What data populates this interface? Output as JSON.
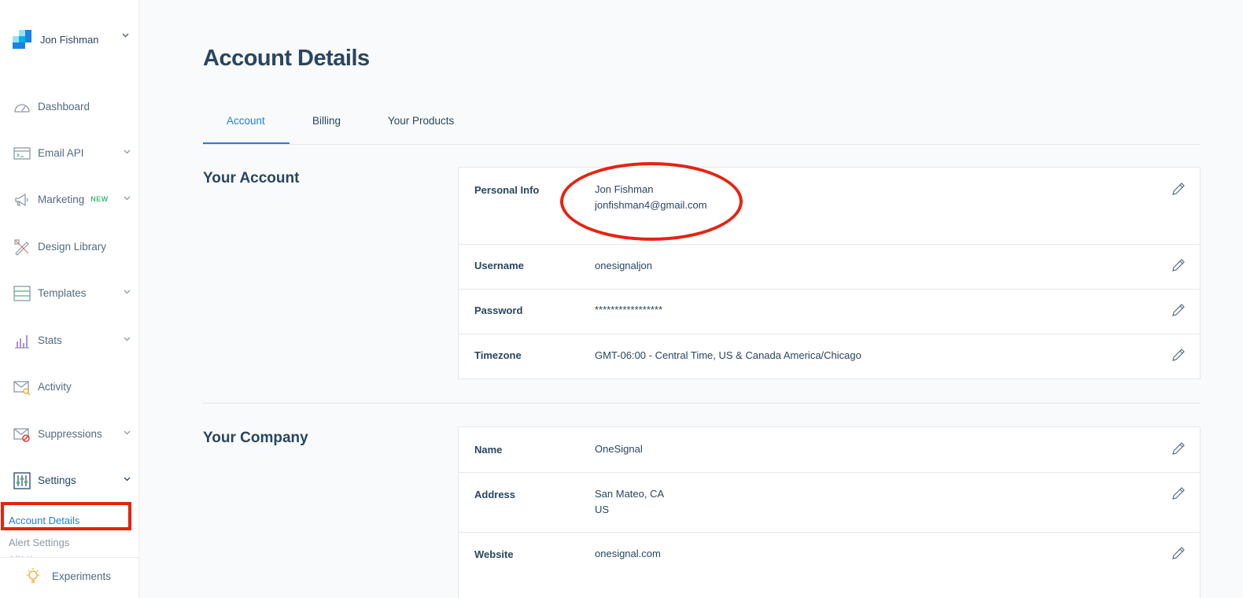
{
  "user": {
    "name": "Jon Fishman"
  },
  "sidebar": {
    "items": [
      {
        "label": "Dashboard",
        "icon": "dashboard-icon"
      },
      {
        "label": "Email API",
        "icon": "terminal-icon",
        "caret": true
      },
      {
        "label": "Marketing",
        "badge": "NEW",
        "icon": "megaphone-icon",
        "caret": true
      },
      {
        "label": "Design Library",
        "icon": "design-icon"
      },
      {
        "label": "Templates",
        "icon": "templates-icon",
        "caret": true
      },
      {
        "label": "Stats",
        "icon": "stats-icon",
        "caret": true
      },
      {
        "label": "Activity",
        "icon": "activity-icon"
      },
      {
        "label": "Suppressions",
        "icon": "suppressions-icon",
        "caret": true
      },
      {
        "label": "Settings",
        "icon": "settings-icon",
        "caret": true
      }
    ],
    "settings_sub": {
      "account_details": "Account Details",
      "alert_settings": "Alert Settings",
      "partial": "API Keys"
    },
    "experiments": "Experiments"
  },
  "page": {
    "title": "Account Details",
    "tabs": [
      "Account",
      "Billing",
      "Your Products"
    ]
  },
  "your_account": {
    "title": "Your Account",
    "personal_info_label": "Personal Info",
    "personal_name": "Jon Fishman",
    "personal_email": "jonfishman4@gmail.com",
    "username_label": "Username",
    "username": "onesignaljon",
    "password_label": "Password",
    "password": "*****************",
    "timezone_label": "Timezone",
    "timezone": "GMT-06:00 - Central Time, US & Canada America/Chicago"
  },
  "your_company": {
    "title": "Your Company",
    "name_label": "Name",
    "name": "OneSignal",
    "address_label": "Address",
    "address_line1": "San Mateo, CA",
    "address_line2": "US",
    "website_label": "Website",
    "website": "onesignal.com"
  },
  "colors": {
    "accent": "#1a82e2",
    "annotation": "#e8220f",
    "text": "#294661",
    "new_badge": "#3ec178"
  }
}
